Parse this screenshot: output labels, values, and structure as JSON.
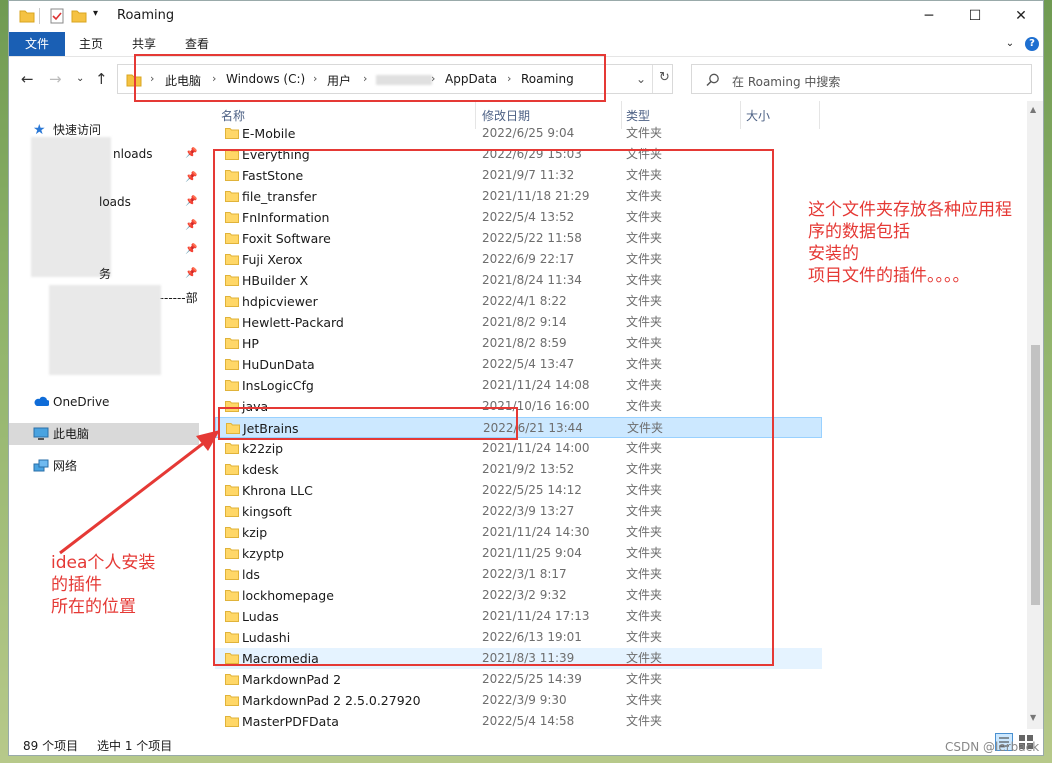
{
  "window": {
    "title": "Roaming"
  },
  "ribbon": {
    "tabs": [
      "文件",
      "主页",
      "共享",
      "查看"
    ]
  },
  "address": {
    "crumbs": [
      "此电脑",
      "Windows (C:)",
      "用户",
      "AppData",
      "Roaming"
    ]
  },
  "search": {
    "placeholder": "在 Roaming 中搜索"
  },
  "sidebar": {
    "quick_access": "快速访问",
    "item_downloads1": "nloads",
    "item_downloads2": "loads",
    "item_tasks": "务",
    "item_dept": "--------部",
    "onedrive": "OneDrive",
    "this_pc": "此电脑",
    "network": "网络"
  },
  "columns": {
    "name": "名称",
    "date": "修改日期",
    "type": "类型",
    "size": "大小"
  },
  "files": [
    {
      "name": "E-Mobile",
      "date": "2022/6/25 9:04",
      "type": "文件夹"
    },
    {
      "name": "Everything",
      "date": "2022/6/29 15:03",
      "type": "文件夹"
    },
    {
      "name": "FastStone",
      "date": "2021/9/7 11:32",
      "type": "文件夹"
    },
    {
      "name": "file_transfer",
      "date": "2021/11/18 21:29",
      "type": "文件夹"
    },
    {
      "name": "FnInformation",
      "date": "2022/5/4 13:52",
      "type": "文件夹"
    },
    {
      "name": "Foxit Software",
      "date": "2022/5/22 11:58",
      "type": "文件夹"
    },
    {
      "name": "Fuji Xerox",
      "date": "2022/6/9 22:17",
      "type": "文件夹"
    },
    {
      "name": "HBuilder X",
      "date": "2021/8/24 11:34",
      "type": "文件夹"
    },
    {
      "name": "hdpicviewer",
      "date": "2022/4/1 8:22",
      "type": "文件夹"
    },
    {
      "name": "Hewlett-Packard",
      "date": "2021/8/2 9:14",
      "type": "文件夹"
    },
    {
      "name": "HP",
      "date": "2021/8/2 8:59",
      "type": "文件夹"
    },
    {
      "name": "HuDunData",
      "date": "2022/5/4 13:47",
      "type": "文件夹"
    },
    {
      "name": "InsLogicCfg",
      "date": "2021/11/24 14:08",
      "type": "文件夹"
    },
    {
      "name": "java",
      "date": "2021/10/16 16:00",
      "type": "文件夹"
    },
    {
      "name": "JetBrains",
      "date": "2022/6/21 13:44",
      "type": "文件夹"
    },
    {
      "name": "k22zip",
      "date": "2021/11/24 14:00",
      "type": "文件夹"
    },
    {
      "name": "kdesk",
      "date": "2021/9/2 13:52",
      "type": "文件夹"
    },
    {
      "name": "Khrona LLC",
      "date": "2022/5/25 14:12",
      "type": "文件夹"
    },
    {
      "name": "kingsoft",
      "date": "2022/3/9 13:27",
      "type": "文件夹"
    },
    {
      "name": "kzip",
      "date": "2021/11/24 14:30",
      "type": "文件夹"
    },
    {
      "name": "kzyptp",
      "date": "2021/11/25 9:04",
      "type": "文件夹"
    },
    {
      "name": "lds",
      "date": "2022/3/1 8:17",
      "type": "文件夹"
    },
    {
      "name": "lockhomepage",
      "date": "2022/3/2 9:32",
      "type": "文件夹"
    },
    {
      "name": "Ludas",
      "date": "2021/11/24 17:13",
      "type": "文件夹"
    },
    {
      "name": "Ludashi",
      "date": "2022/6/13 19:01",
      "type": "文件夹"
    },
    {
      "name": "Macromedia",
      "date": "2021/8/3 11:39",
      "type": "文件夹"
    },
    {
      "name": "MarkdownPad 2",
      "date": "2022/5/25 14:39",
      "type": "文件夹"
    },
    {
      "name": "MarkdownPad 2 2.5.0.27920",
      "date": "2022/3/9 9:30",
      "type": "文件夹"
    },
    {
      "name": "MasterPDFData",
      "date": "2022/5/4 14:58",
      "type": "文件夹"
    }
  ],
  "status": {
    "count": "89 个项目",
    "selected": "选中 1 个项目"
  },
  "annotations": {
    "note_right": [
      "这个文件夹存放各种应用程",
      "序的数据包括",
      "安装的",
      "项目文件的插件。。。。"
    ],
    "note_left": [
      "idea个人安装",
      "的插件",
      "所在的位置"
    ]
  },
  "watermark": "CSDN @lerback",
  "colors": {
    "accent": "#1a5fb4",
    "annotation": "#e53935",
    "selection": "#cce8ff"
  }
}
